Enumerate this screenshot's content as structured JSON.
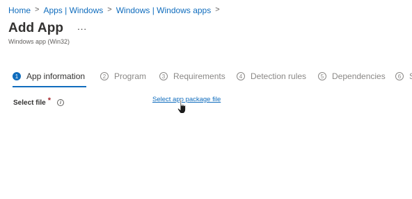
{
  "breadcrumb": {
    "items": [
      "Home",
      "Apps | Windows",
      "Windows | Windows apps"
    ],
    "separator": ">"
  },
  "page": {
    "title": "Add App",
    "more_label": "...",
    "subtitle": "Windows app (Win32)"
  },
  "steps": [
    {
      "number": "1",
      "label": "App information",
      "active": true
    },
    {
      "number": "2",
      "label": "Program",
      "active": false
    },
    {
      "number": "3",
      "label": "Requirements",
      "active": false
    },
    {
      "number": "4",
      "label": "Detection rules",
      "active": false
    },
    {
      "number": "5",
      "label": "Dependencies",
      "active": false
    },
    {
      "number": "6",
      "label": "S",
      "active": false
    }
  ],
  "form": {
    "select_file_label": "Select file",
    "required_mark": "*",
    "info_icon": "info-icon",
    "select_package_link": "Select app package file"
  },
  "colors": {
    "accent": "#0f6cbd",
    "text": "#323130",
    "muted": "#8a8886",
    "required": "#a4262c"
  }
}
